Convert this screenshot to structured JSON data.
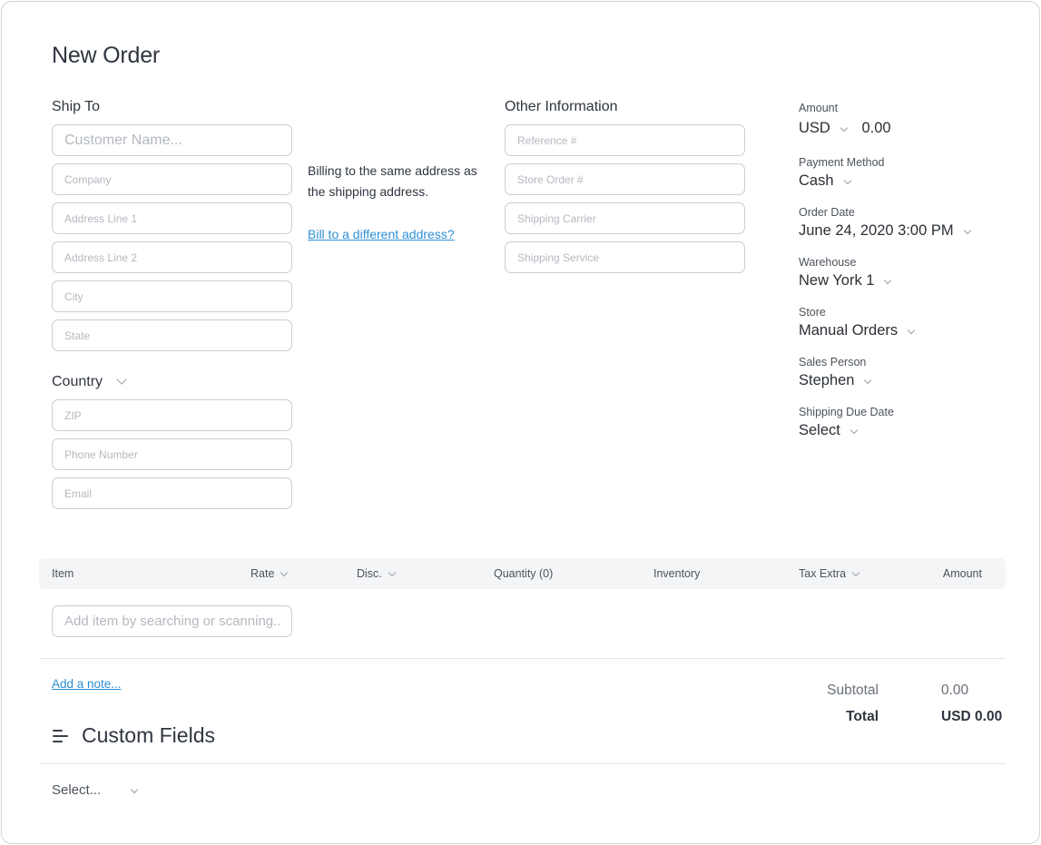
{
  "page": {
    "title": "New Order"
  },
  "ship_to": {
    "label": "Ship To",
    "customer_name_placeholder": "Customer Name...",
    "company_placeholder": "Company",
    "address1_placeholder": "Address Line 1",
    "address2_placeholder": "Address Line 2",
    "city_placeholder": "City",
    "state_placeholder": "State",
    "country_label": "Country",
    "zip_placeholder": "ZIP",
    "phone_placeholder": "Phone Number",
    "email_placeholder": "Email"
  },
  "billing": {
    "note": "Billing to the same address as the shipping address.",
    "link": "Bill to a different address?"
  },
  "other_info": {
    "label": "Other Information",
    "reference_placeholder": "Reference #",
    "store_order_placeholder": "Store Order #",
    "carrier_placeholder": "Shipping Carrier",
    "service_placeholder": "Shipping Service"
  },
  "side": {
    "amount_label": "Amount",
    "currency": "USD",
    "amount_value": "0.00",
    "payment_label": "Payment Method",
    "payment_value": "Cash",
    "order_date_label": "Order Date",
    "order_date_value": "June 24, 2020 3:00 PM",
    "warehouse_label": "Warehouse",
    "warehouse_value": "New York 1",
    "store_label": "Store",
    "store_value": "Manual Orders",
    "sales_label": "Sales Person",
    "sales_value": "Stephen",
    "due_label": "Shipping Due Date",
    "due_value": "Select"
  },
  "items_table": {
    "columns": [
      "Item",
      "Rate",
      "Disc.",
      "Quantity (0)",
      "Inventory",
      "Tax Extra",
      "Amount"
    ],
    "add_item_placeholder": "Add item by searching or scanning..."
  },
  "footer": {
    "add_note": "Add a note...",
    "subtotal_label": "Subtotal",
    "subtotal_value": "0.00",
    "total_label": "Total",
    "total_value": "USD 0.00"
  },
  "custom_fields": {
    "title": "Custom Fields",
    "select_value": "Select..."
  },
  "icons": {
    "menu": "menu-lines-icon",
    "dropdown": "chevron-down-icon"
  }
}
